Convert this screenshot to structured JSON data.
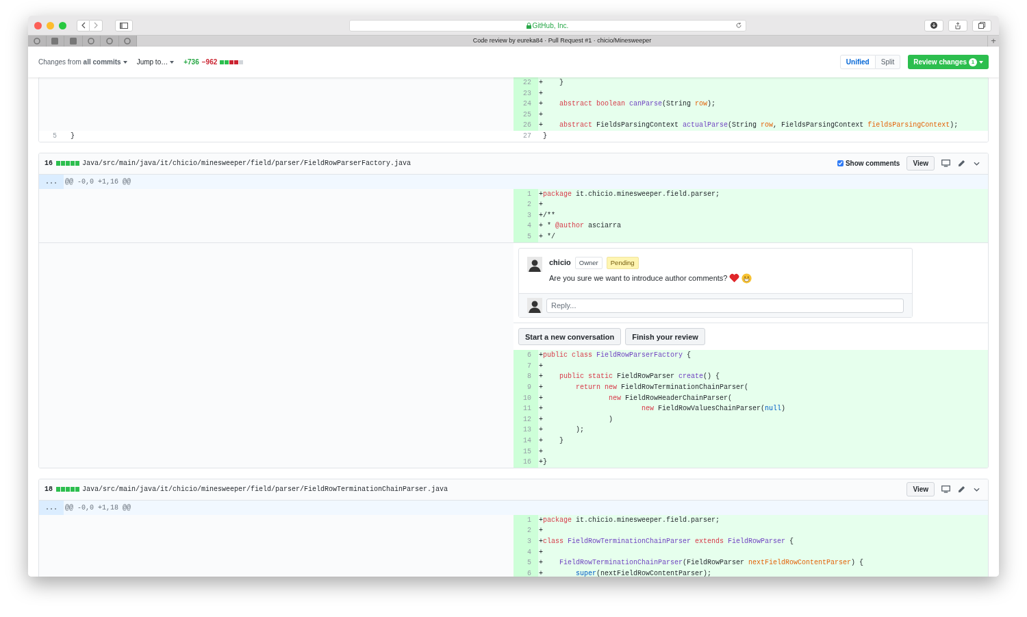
{
  "browser": {
    "address": "GitHub, Inc.",
    "tab_title": "Code review by eureka84 · Pull Request #1 · chicio/Minesweeper",
    "new_tab": "+"
  },
  "toolbar": {
    "changes_from": "Changes from **all commits**",
    "jump_to": "Jump to…",
    "additions": "+736",
    "deletions": "−962",
    "diffstat": [
      {
        "color": "#2cbe4e"
      },
      {
        "color": "#2cbe4e"
      },
      {
        "color": "#cb2431"
      },
      {
        "color": "#cb2431"
      },
      {
        "color": "#d1d5da"
      }
    ],
    "view_modes": [
      {
        "label": "Unified",
        "selected": true
      },
      {
        "label": "Split",
        "selected": false
      }
    ],
    "review_button": {
      "label": "Review changes",
      "badge": "1"
    }
  },
  "files": [
    {
      "blocks": [
        {
          "kind": "rows",
          "rows": [
            {
              "added": true,
              "right_num": "22",
              "right": [
                {
                  "t": "+    }",
                  "kind": "plain"
                }
              ]
            },
            {
              "added": true,
              "right_num": "23",
              "right": [
                {
                  "t": "+",
                  "kind": "plain"
                }
              ]
            },
            {
              "added": true,
              "right_num": "24",
              "right": [
                {
                  "t": "+    ",
                  "kind": "plain"
                },
                {
                  "t": "abstract boolean ",
                  "kind": "keyword"
                },
                {
                  "t": "canParse",
                  "kind": "entity"
                },
                {
                  "t": "(String ",
                  "kind": "plain"
                },
                {
                  "t": "row",
                  "kind": "parameter"
                },
                {
                  "t": ");",
                  "kind": "plain"
                }
              ]
            },
            {
              "added": true,
              "right_num": "25",
              "right": [
                {
                  "t": "+",
                  "kind": "plain"
                }
              ]
            },
            {
              "added": true,
              "right_num": "26",
              "right": [
                {
                  "t": "+    ",
                  "kind": "plain"
                },
                {
                  "t": "abstract",
                  "kind": "keyword"
                },
                {
                  "t": " FieldsParsingContext ",
                  "kind": "plain"
                },
                {
                  "t": "actualParse",
                  "kind": "entity"
                },
                {
                  "t": "(String ",
                  "kind": "plain"
                },
                {
                  "t": "row",
                  "kind": "parameter"
                },
                {
                  "t": ", FieldsParsingContext ",
                  "kind": "plain"
                },
                {
                  "t": "fieldsParsingContext",
                  "kind": "parameter"
                },
                {
                  "t": ");",
                  "kind": "plain"
                }
              ]
            },
            {
              "added": false,
              "left_num": "5",
              "left": [
                {
                  "t": " }",
                  "kind": "plain"
                }
              ],
              "right_num": "27",
              "right": [
                {
                  "t": " }",
                  "kind": "plain"
                }
              ]
            }
          ]
        }
      ]
    },
    {
      "header": {
        "count": "16",
        "path": "Java/src/main/java/it/chicio/minesweeper/field/parser/FieldRowParserFactory.java",
        "show_comments": {
          "label": "Show comments",
          "checked": true
        },
        "view_button": "View"
      },
      "hunk": {
        "expander": "...",
        "text": "@@ -0,0 +1,16 @@"
      },
      "blocks": [
        {
          "kind": "rows",
          "rows": [
            {
              "added": true,
              "right_num": "1",
              "right": [
                {
                  "t": "+",
                  "kind": "plain"
                },
                {
                  "t": "package",
                  "kind": "keyword"
                },
                {
                  "t": " it.chicio.minesweeper.field.parser;",
                  "kind": "plain"
                }
              ]
            },
            {
              "added": true,
              "right_num": "2",
              "right": [
                {
                  "t": "+",
                  "kind": "plain"
                }
              ]
            },
            {
              "added": true,
              "right_num": "3",
              "right": [
                {
                  "t": "+/**",
                  "kind": "plain"
                }
              ]
            },
            {
              "added": true,
              "right_num": "4",
              "right": [
                {
                  "t": "+ * ",
                  "kind": "plain"
                },
                {
                  "t": "@author",
                  "kind": "keyword"
                },
                {
                  "t": " asciarra",
                  "kind": "plain"
                }
              ]
            },
            {
              "added": true,
              "right_num": "5",
              "right": [
                {
                  "t": "+ */",
                  "kind": "plain"
                }
              ]
            }
          ]
        },
        {
          "kind": "thread",
          "author": "chicio",
          "role": "Owner",
          "status": "Pending",
          "body": "Are you sure we want to introduce author comments?",
          "reply_placeholder": "Reply..."
        },
        {
          "kind": "actions",
          "buttons": [
            "Start a new conversation",
            "Finish your review"
          ]
        },
        {
          "kind": "rows",
          "rows": [
            {
              "added": true,
              "right_num": "6",
              "right": [
                {
                  "t": "+",
                  "kind": "plain"
                },
                {
                  "t": "public class ",
                  "kind": "keyword"
                },
                {
                  "t": "FieldRowParserFactory",
                  "kind": "entity"
                },
                {
                  "t": " {",
                  "kind": "plain"
                }
              ]
            },
            {
              "added": true,
              "right_num": "7",
              "right": [
                {
                  "t": "+",
                  "kind": "plain"
                }
              ]
            },
            {
              "added": true,
              "right_num": "8",
              "right": [
                {
                  "t": "+    ",
                  "kind": "plain"
                },
                {
                  "t": "public static",
                  "kind": "keyword"
                },
                {
                  "t": " FieldRowParser ",
                  "kind": "plain"
                },
                {
                  "t": "create",
                  "kind": "entity"
                },
                {
                  "t": "() {",
                  "kind": "plain"
                }
              ]
            },
            {
              "added": true,
              "right_num": "9",
              "right": [
                {
                  "t": "+        ",
                  "kind": "plain"
                },
                {
                  "t": "return new",
                  "kind": "keyword"
                },
                {
                  "t": " FieldRowTerminationChainParser(",
                  "kind": "plain"
                }
              ]
            },
            {
              "added": true,
              "right_num": "10",
              "right": [
                {
                  "t": "+                ",
                  "kind": "plain"
                },
                {
                  "t": "new",
                  "kind": "keyword"
                },
                {
                  "t": " FieldRowHeaderChainParser(",
                  "kind": "plain"
                }
              ]
            },
            {
              "added": true,
              "right_num": "11",
              "right": [
                {
                  "t": "+                        ",
                  "kind": "plain"
                },
                {
                  "t": "new",
                  "kind": "keyword"
                },
                {
                  "t": " FieldRowValuesChainParser(",
                  "kind": "plain"
                },
                {
                  "t": "null",
                  "kind": "constant"
                },
                {
                  "t": ")",
                  "kind": "plain"
                }
              ]
            },
            {
              "added": true,
              "right_num": "12",
              "right": [
                {
                  "t": "+                )",
                  "kind": "plain"
                }
              ]
            },
            {
              "added": true,
              "right_num": "13",
              "right": [
                {
                  "t": "+        );",
                  "kind": "plain"
                }
              ]
            },
            {
              "added": true,
              "right_num": "14",
              "right": [
                {
                  "t": "+    }",
                  "kind": "plain"
                }
              ]
            },
            {
              "added": true,
              "right_num": "15",
              "right": [
                {
                  "t": "+",
                  "kind": "plain"
                }
              ]
            },
            {
              "added": true,
              "right_num": "16",
              "right": [
                {
                  "t": "+}",
                  "kind": "plain"
                }
              ]
            }
          ]
        }
      ]
    },
    {
      "header": {
        "count": "18",
        "path": "Java/src/main/java/it/chicio/minesweeper/field/parser/FieldRowTerminationChainParser.java",
        "view_button": "View"
      },
      "hunk": {
        "expander": "...",
        "text": "@@ -0,0 +1,18 @@"
      },
      "blocks": [
        {
          "kind": "rows",
          "rows": [
            {
              "added": true,
              "right_num": "1",
              "right": [
                {
                  "t": "+",
                  "kind": "plain"
                },
                {
                  "t": "package",
                  "kind": "keyword"
                },
                {
                  "t": " it.chicio.minesweeper.field.parser;",
                  "kind": "plain"
                }
              ]
            },
            {
              "added": true,
              "right_num": "2",
              "right": [
                {
                  "t": "+",
                  "kind": "plain"
                }
              ]
            },
            {
              "added": true,
              "right_num": "3",
              "right": [
                {
                  "t": "+",
                  "kind": "plain"
                },
                {
                  "t": "class ",
                  "kind": "keyword"
                },
                {
                  "t": "FieldRowTerminationChainParser ",
                  "kind": "entity"
                },
                {
                  "t": "extends ",
                  "kind": "keyword"
                },
                {
                  "t": "FieldRowParser",
                  "kind": "entity"
                },
                {
                  "t": " {",
                  "kind": "plain"
                }
              ]
            },
            {
              "added": true,
              "right_num": "4",
              "right": [
                {
                  "t": "+",
                  "kind": "plain"
                }
              ]
            },
            {
              "added": true,
              "right_num": "5",
              "right": [
                {
                  "t": "+    ",
                  "kind": "plain"
                },
                {
                  "t": "FieldRowTerminationChainParser",
                  "kind": "entity"
                },
                {
                  "t": "(FieldRowParser ",
                  "kind": "plain"
                },
                {
                  "t": "nextFieldRowContentParser",
                  "kind": "parameter"
                },
                {
                  "t": ") {",
                  "kind": "plain"
                }
              ]
            },
            {
              "added": true,
              "right_num": "6",
              "right": [
                {
                  "t": "+        ",
                  "kind": "plain"
                },
                {
                  "t": "super",
                  "kind": "constant"
                },
                {
                  "t": "(nextFieldRowContentParser);",
                  "kind": "plain"
                }
              ]
            }
          ]
        }
      ]
    }
  ]
}
